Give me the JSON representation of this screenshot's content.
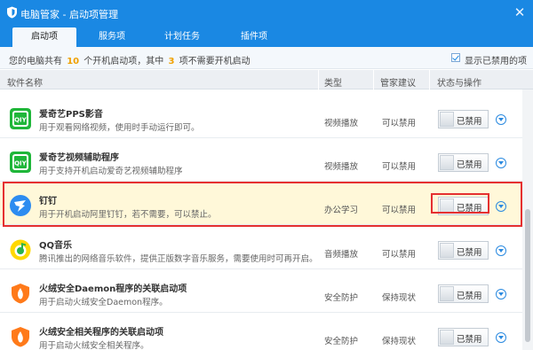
{
  "window": {
    "title": "电脑管家 - 启动项管理",
    "close_glyph": "✕",
    "icon": "shield-icon"
  },
  "tabs": [
    {
      "label": "启动项",
      "active": true
    },
    {
      "label": "服务项",
      "active": false
    },
    {
      "label": "计划任务",
      "active": false
    },
    {
      "label": "插件项",
      "active": false
    }
  ],
  "summary": {
    "prefix": "您的电脑共有",
    "total": "10",
    "mid": "个开机启动项，其中",
    "unneeded": "3",
    "suffix": "项不需要开机启动",
    "show_disabled_label": "显示已禁用的项",
    "show_disabled_checked": true
  },
  "columns": {
    "name": "软件名称",
    "type": "类型",
    "advice": "管家建议",
    "status": "状态与操作"
  },
  "items": [
    {
      "name": "爱奇艺PPS影音",
      "desc": "用于观看网络视频，使用时手动运行即可。",
      "type": "视频播放",
      "advice": "可以禁用",
      "status": "已禁用",
      "icon": "iqiyi-icon",
      "highlight": false
    },
    {
      "name": "爱奇艺视频辅助程序",
      "desc": "用于支持开机启动爱奇艺视频辅助程序",
      "type": "视频播放",
      "advice": "可以禁用",
      "status": "已禁用",
      "icon": "iqiyi-icon",
      "highlight": false
    },
    {
      "name": "钉钉",
      "desc": "用于开机启动阿里钉钉，若不需要，可以禁止。",
      "type": "办公学习",
      "advice": "可以禁用",
      "status": "已禁用",
      "icon": "dingtalk-icon",
      "highlight": true
    },
    {
      "name": "QQ音乐",
      "desc": "腾讯推出的网络音乐软件，提供正版数字音乐服务，需要使用时可再开启。",
      "type": "音频播放",
      "advice": "可以禁用",
      "status": "已禁用",
      "icon": "qqmusic-icon",
      "highlight": false
    },
    {
      "name": "火绒安全Daemon程序的关联启动项",
      "desc": "用于启动火绒安全Daemon程序。",
      "type": "安全防护",
      "advice": "保持现状",
      "status": "已禁用",
      "icon": "huorong-icon",
      "highlight": false
    },
    {
      "name": "火绒安全相关程序的关联启动项",
      "desc": "用于启动火绒安全相关程序。",
      "type": "安全防护",
      "advice": "保持现状",
      "status": "已禁用",
      "icon": "huorong-icon",
      "highlight": false
    }
  ],
  "colors": {
    "titlebar": "#1a88e3",
    "highlight_row": "#fff8d9",
    "annotation": "#e53030",
    "count": "#f0a000",
    "iqiyi": "#1fb639",
    "dingtalk": "#2d8cf0",
    "qqmusic": "#ffd800",
    "huorong": "#ff7a1a"
  }
}
